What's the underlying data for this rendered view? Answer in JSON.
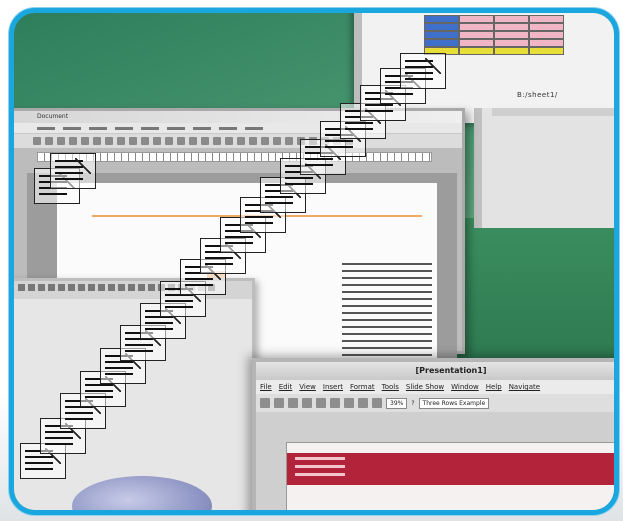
{
  "image": {
    "frame_color": "#1aa7e0"
  },
  "spreadsheet_window": {
    "path_text": "B:/sheet1/"
  },
  "document_window": {
    "title": "Document"
  },
  "presentation_window": {
    "title": "[Presentation1]",
    "menu": [
      "File",
      "Edit",
      "View",
      "Insert",
      "Format",
      "Tools",
      "Slide Show",
      "Window",
      "Help",
      "Navigate"
    ],
    "zoom": "39%",
    "help_label": "?",
    "style_box": "Three Rows Example"
  },
  "colors": {
    "accent_blue": "#1aa7e0",
    "slide_red": "#b3243a",
    "desktop_green": "#2f7a52"
  }
}
